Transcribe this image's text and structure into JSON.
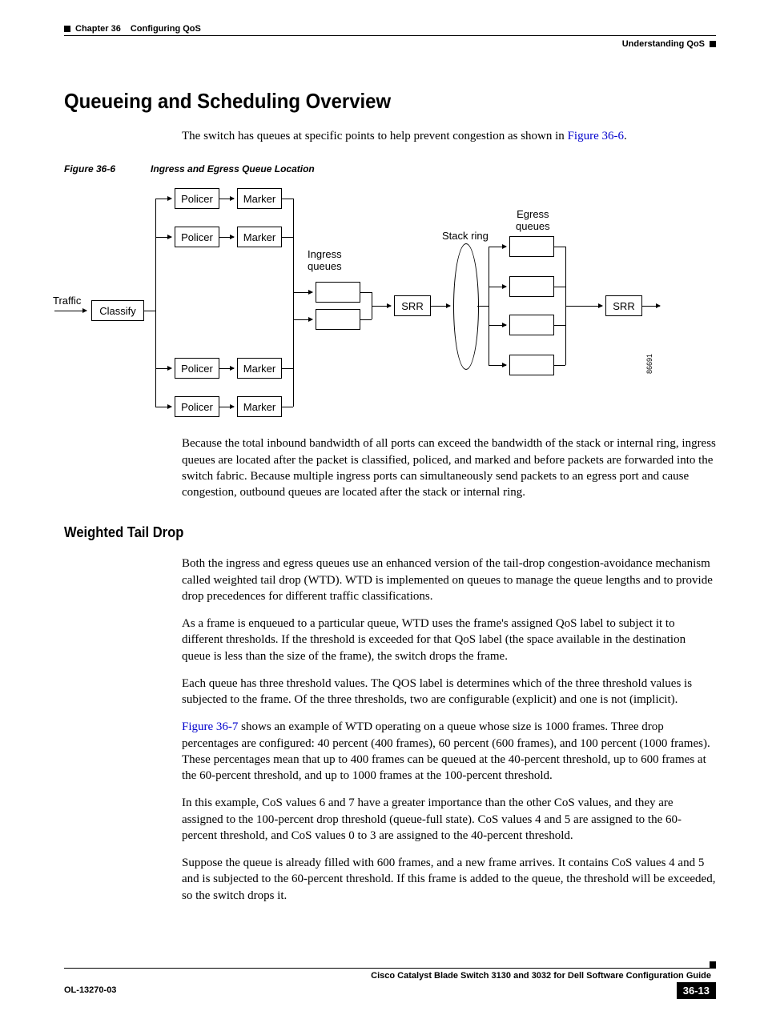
{
  "header": {
    "chapter": "Chapter 36",
    "chapter_title": "Configuring QoS",
    "section": "Understanding QoS"
  },
  "h1": "Queueing and Scheduling Overview",
  "intro": "The switch has queues at specific points to help prevent congestion as shown in ",
  "intro_link": "Figure 36-6",
  "intro_end": ".",
  "figure": {
    "number": "Figure 36-6",
    "title": "Ingress and Egress Queue Location",
    "traffic": "Traffic",
    "classify": "Classify",
    "policer": "Policer",
    "marker": "Marker",
    "ingress": "Ingress\nqueues",
    "srr": "SRR",
    "stack": "Stack ring",
    "egress": "Egress\nqueues",
    "id": "86691"
  },
  "para2": "Because the total inbound bandwidth of all ports can exceed the bandwidth of the stack or internal ring, ingress queues are located after the packet is classified, policed, and marked and before packets are forwarded into the switch fabric. Because multiple ingress ports can simultaneously send packets to an egress port and cause congestion, outbound queues are located after the stack or internal ring.",
  "h2": "Weighted Tail Drop",
  "para3": "Both the ingress and egress queues use an enhanced version of the tail-drop congestion-avoidance mechanism called weighted tail drop (WTD). WTD is implemented on queues to manage the queue lengths and to provide drop precedences for different traffic classifications.",
  "para4": "As a frame is enqueued to a particular queue, WTD uses the frame's assigned QoS label to subject it to different thresholds. If the threshold is exceeded for that QoS label (the space available in the destination queue is less than the size of the frame), the switch drops the frame.",
  "para5": "Each queue has three threshold values. The QOS label is determines which of the three threshold values is subjected to the frame. Of the three thresholds, two are configurable (explicit) and one is not (implicit).",
  "para6_link": "Figure 36-7",
  "para6": " shows an example of WTD operating on a queue whose size is 1000 frames. Three drop percentages are configured: 40 percent (400 frames), 60 percent (600 frames), and 100 percent (1000 frames). These percentages mean that up to 400 frames can be queued at the 40-percent threshold, up to 600 frames at the 60-percent threshold, and up to 1000 frames at the 100-percent threshold.",
  "para7": "In this example, CoS values 6 and 7 have a greater importance than the other CoS values, and they are assigned to the 100-percent drop threshold (queue-full state). CoS values 4 and 5 are assigned to the 60-percent threshold, and CoS values 0 to 3 are assigned to the 40-percent threshold.",
  "para8": "Suppose the queue is already filled with 600 frames, and a new frame arrives. It contains CoS values 4 and 5 and is subjected to the 60-percent threshold. If this frame is added to the queue, the threshold will be exceeded, so the switch drops it.",
  "footer": {
    "guide": "Cisco Catalyst Blade Switch 3130 and 3032 for Dell Software Configuration Guide",
    "doc": "OL-13270-03",
    "page": "36-13"
  }
}
